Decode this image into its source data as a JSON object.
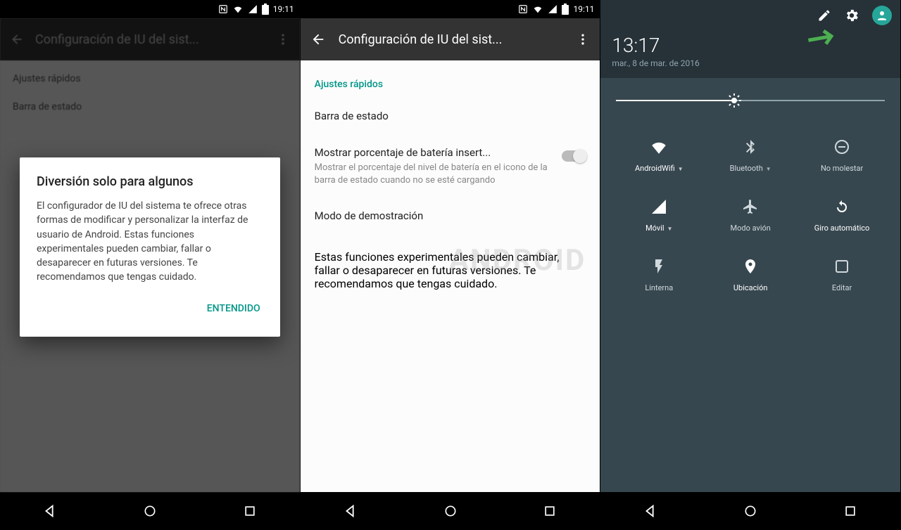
{
  "status_bar": {
    "time": "19:11"
  },
  "phone1": {
    "appbar_title": "Configuración de IU del sist...",
    "section1": "Ajustes rápidos",
    "section2": "Barra de estado",
    "dialog": {
      "title": "Diversión solo para algunos",
      "body": "El configurador de IU del sistema te ofrece otras formas de modificar y personalizar la interfaz de usuario de Android. Estas funciones experimentales pueden cambiar, fallar o desaparecer en futuras versiones. Te recomendamos que tengas cuidado.",
      "ok": "Entendido"
    }
  },
  "phone2": {
    "appbar_title": "Configuración de IU del sist...",
    "sect_quick": "Ajustes rápidos",
    "sect_status": "Barra de estado",
    "item_battery": {
      "title": "Mostrar porcentaje de batería insert...",
      "sub": "Mostrar el porcentaje del nivel de batería en el icono de la barra de estado cuando no se esté cargando"
    },
    "item_demo_title": "Modo de demostración",
    "footer": "Estas funciones experimentales pueden cambiar, fallar o desaparecer en futuras versiones. Te recomendamos que tengas cuidado.",
    "watermark": "ANDROID"
  },
  "phone3": {
    "carrier": "",
    "time": "13:17",
    "date": "mar., 8 de mar. de 2016",
    "tiles": [
      {
        "label": "AndroidWifi",
        "active": true,
        "icon": "wifi",
        "dd": true
      },
      {
        "label": "Bluetooth",
        "active": false,
        "icon": "bluetooth",
        "dd": true
      },
      {
        "label": "No molestar",
        "active": false,
        "icon": "dnd"
      },
      {
        "label": "Móvil",
        "active": true,
        "icon": "cell",
        "dd": true
      },
      {
        "label": "Modo avión",
        "active": false,
        "icon": "airplane"
      },
      {
        "label": "Giro automático",
        "active": true,
        "icon": "rotate"
      },
      {
        "label": "Linterna",
        "active": false,
        "icon": "flash"
      },
      {
        "label": "Ubicación",
        "active": true,
        "icon": "location"
      },
      {
        "label": "Editar",
        "active": false,
        "icon": "edit-tile"
      }
    ]
  },
  "nav": {
    "back": "back",
    "home": "home",
    "recent": "recent"
  }
}
